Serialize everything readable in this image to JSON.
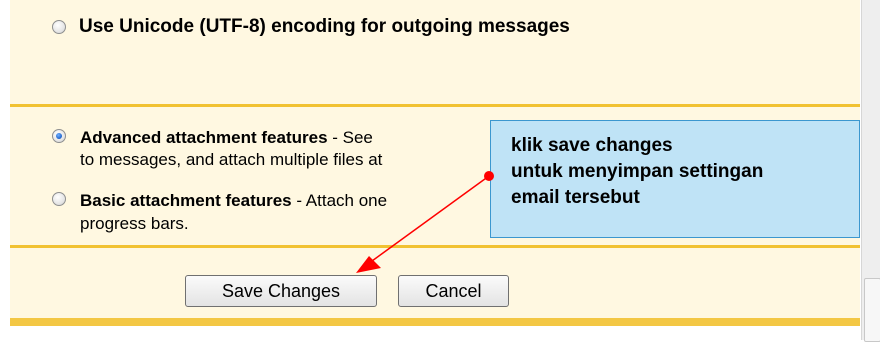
{
  "options": {
    "unicode": {
      "label": "Use Unicode (UTF-8) encoding for outgoing messages"
    },
    "advanced": {
      "title": "Advanced attachment features",
      "desc_line1": " - See",
      "desc_line2": "to messages, and attach multiple files at"
    },
    "basic": {
      "title": "Basic attachment features",
      "desc_line1": " - Attach one",
      "desc_line2": "progress bars."
    }
  },
  "buttons": {
    "save": "Save Changes",
    "cancel": "Cancel"
  },
  "callout": {
    "line1": "klik save changes",
    "line2": "untuk menyimpan settingan",
    "line3": "email tersebut"
  },
  "colors": {
    "panel_bg": "#fff8e1",
    "rule": "#f1c232",
    "callout_bg": "#bfe3f6",
    "arrow": "#ff0000"
  }
}
